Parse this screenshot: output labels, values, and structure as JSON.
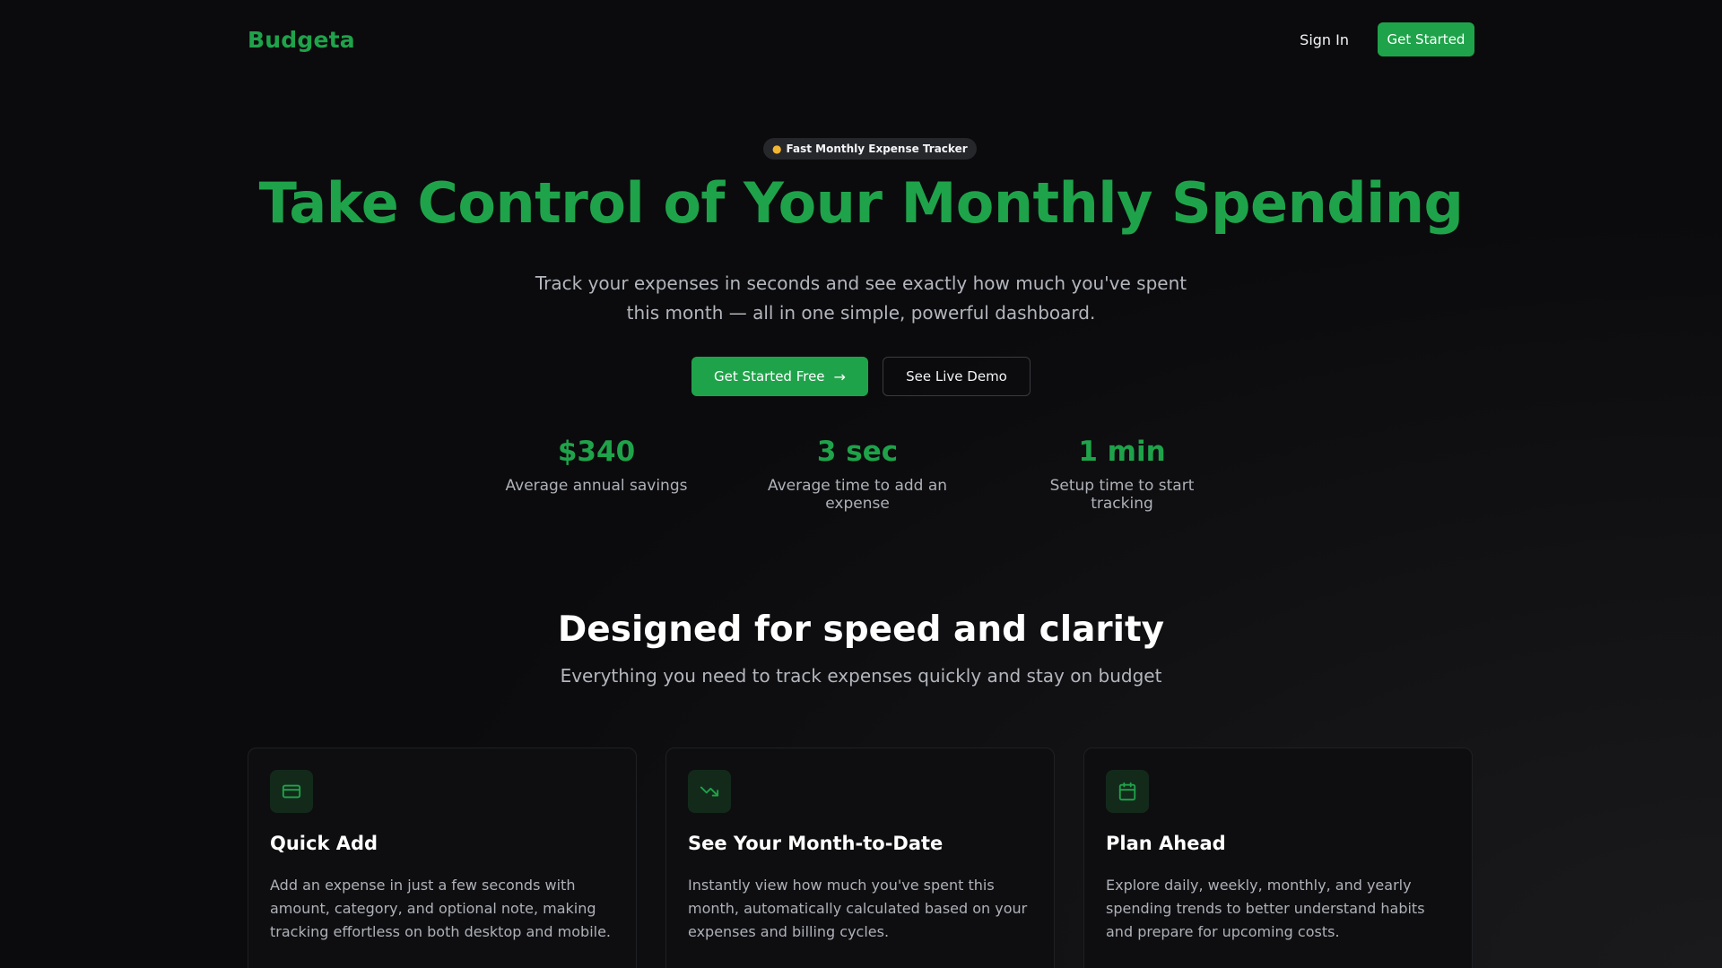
{
  "header": {
    "logo": "Budgeta",
    "sign_in": "Sign In",
    "get_started": "Get Started"
  },
  "hero": {
    "badge_icon": "money-bag-icon",
    "badge": "Fast Monthly Expense Tracker",
    "title": "Take Control of Your Monthly Spending",
    "subtitle": "Track your expenses in seconds and see exactly how much you've spent this month — all in one simple, powerful dashboard.",
    "cta_primary": "Get Started Free",
    "cta_secondary": "See Live Demo"
  },
  "stats": [
    {
      "value": "$340",
      "label": "Average annual savings"
    },
    {
      "value": "3 sec",
      "label": "Average time to add an expense"
    },
    {
      "value": "1 min",
      "label": "Setup time to start tracking"
    }
  ],
  "features": {
    "title": "Designed for speed and clarity",
    "subtitle": "Everything you need to track expenses quickly and stay on budget",
    "cards": [
      {
        "icon": "credit-card-icon",
        "title": "Quick Add",
        "description": "Add an expense in just a few seconds with amount, category, and optional note, making tracking effortless on both desktop and mobile."
      },
      {
        "icon": "trending-down-icon",
        "title": "See Your Month-to-Date",
        "description": "Instantly view how much you've spent this month, automatically calculated based on your expenses and billing cycles."
      },
      {
        "icon": "calendar-icon",
        "title": "Plan Ahead",
        "description": "Explore daily, weekly, monthly, and yearly spending trends to better understand habits and prepare for upcoming costs."
      }
    ]
  },
  "colors": {
    "accent": "#1fa34a",
    "background": "#0b0b0d"
  }
}
